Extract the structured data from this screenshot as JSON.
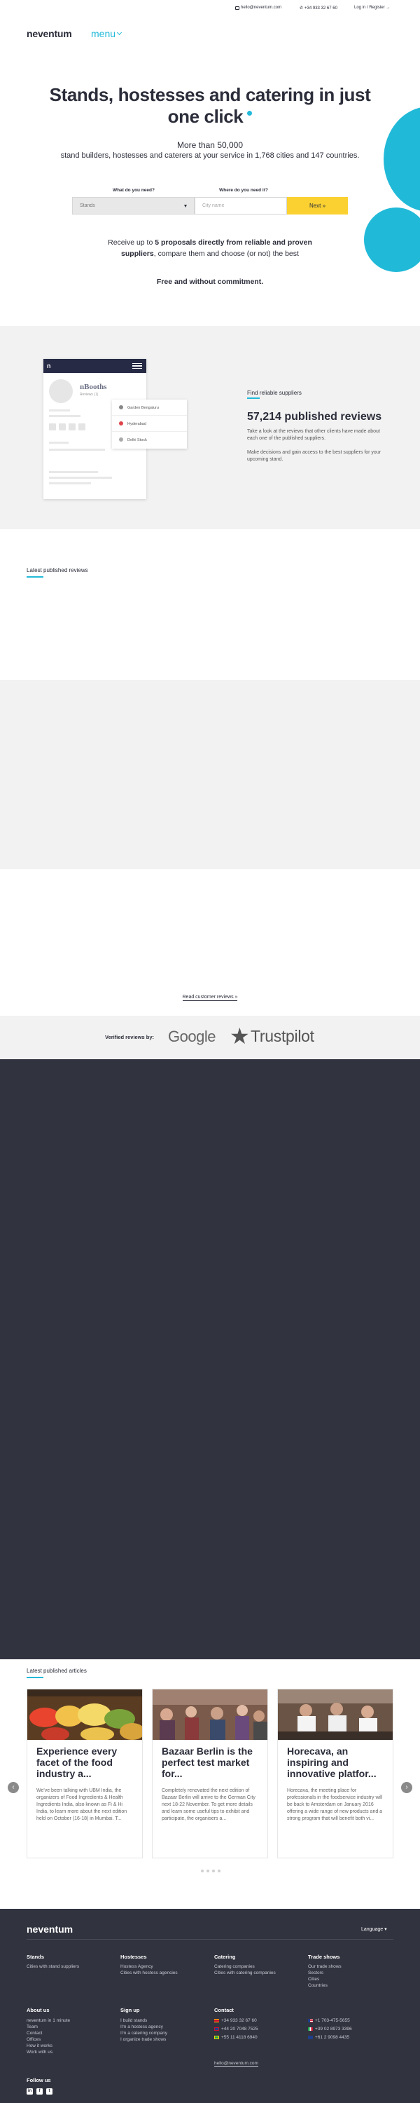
{
  "topbar": {
    "email": "hello@neventum.com",
    "phone": "+34 933 32 67 60",
    "login": "Log in / Register →"
  },
  "header": {
    "logo": "neventum",
    "menu_label": "menu"
  },
  "hero": {
    "title": "Stands, hostesses and catering in just one click",
    "subtitle_line1": "More than 50,000",
    "subtitle_line2": "stand builders, hostesses and caterers at your service in 1,768 cities and 147 countries.",
    "need_label": "What do you need?",
    "need_value": "Stands",
    "where_label": "Where do you need it?",
    "city_placeholder": "City name",
    "next_label": "Next »",
    "promo_pre": "Receive up to ",
    "promo_bold": "5 proposals directly from reliable and proven suppliers",
    "promo_post": ", compare them and choose (or not) the best",
    "free": "Free and without commitment."
  },
  "reviews_promo": {
    "mock_name": "nBooths",
    "mock_meta": "Reviews (1)",
    "mock_cities": [
      "Garden Bengaluru",
      "Hyderabad",
      "Delhi Stock"
    ],
    "label": "Find reliable suppliers",
    "title": "57,214 published reviews",
    "p1": "Take a look at the reviews that other clients have made about each one of the published suppliers.",
    "p2": "Make decisions and gain access to the best suppliers for your upcoming stand."
  },
  "latest_reviews": {
    "label": "Latest published reviews",
    "read_more": "Read customer reviews »"
  },
  "verified": {
    "label": "Verified reviews by:",
    "google": "Google",
    "trustpilot": "Trustpilot"
  },
  "articles": {
    "label": "Latest published articles",
    "items": [
      {
        "title": "Experience every facet of the food industry a...",
        "excerpt": "We've been talking with UBM India, the organizers of Food Ingredients & Health Ingredients India, also known as Fi & Hi India, to learn more about the next edition held on October (16-18) in Mumbai. T..."
      },
      {
        "title": "Bazaar Berlin is the perfect test market for...",
        "excerpt": "Completely renovated the next edition of Bazaar Berlin will arrive to the German City next 18-22 November. To get more details and learn some useful tips to exhibit and participate, the organisers a..."
      },
      {
        "title": "Horecava, an inspiring and innovative platfor...",
        "excerpt": "Horecava, the meeting place for professionals in the foodservice industry will be back to Amsterdam on January 2016 offering a wide range of new products and a strong program that will benefit both vi..."
      }
    ]
  },
  "footer": {
    "logo": "neventum",
    "language": "Language ▾",
    "stands": {
      "title": "Stands",
      "links": [
        "Cities with stand suppliers"
      ]
    },
    "hostesses": {
      "title": "Hostesses",
      "links": [
        "Hostess Agency",
        "Cities with hostess agencies"
      ]
    },
    "catering": {
      "title": "Catering",
      "links": [
        "Catering companies",
        "Cities with catering companies"
      ]
    },
    "trade_shows": {
      "title": "Trade shows",
      "links": [
        "Our trade shows",
        "Sectors",
        "Cities",
        "Countries"
      ]
    },
    "about": {
      "title": "About us",
      "links": [
        "neventum in 1 minute",
        "Team",
        "Contact",
        "Offices",
        "How it works",
        "Work with us"
      ]
    },
    "signup": {
      "title": "Sign up",
      "links": [
        "I build stands",
        "I'm a hostess agency",
        "I'm a catering company",
        "I organize trade shows"
      ]
    },
    "contact": {
      "title": "Contact",
      "phones_left": [
        "+34 933 32 67 60",
        "+44 20 7048 7525",
        "+55 11 4118 6940"
      ],
      "phones_right": [
        "+1 703-475-5655",
        "+39 02 8973 3396",
        "+61 2 9098 4435"
      ],
      "email": "hello@neventum.com"
    },
    "follow": "Follow us",
    "social": [
      "in",
      "f",
      "t"
    ]
  },
  "colors": {
    "accent": "#21b9d8",
    "cta": "#fad131",
    "dark": "#31333f",
    "grey_band": "#f2f2f2"
  }
}
